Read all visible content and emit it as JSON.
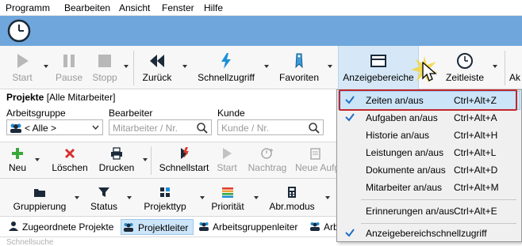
{
  "menubar": {
    "items": [
      "Programm",
      "Bearbeiten",
      "Ansicht",
      "Fenster",
      "Hilfe"
    ]
  },
  "ribbon1": {
    "start": "Start",
    "pause": "Pause",
    "stopp": "Stopp",
    "zurueck": "Zurück",
    "schnellzugriff": "Schnellzugriff",
    "favoriten": "Favoriten",
    "anzeigebereiche": "Anzeigebereiche",
    "zeitleiste": "Zeitleiste",
    "cut_off": "Ak"
  },
  "filter": {
    "title": "Projekte",
    "title_suffix": "[Alle Mitarbeiter]",
    "arbeitsgruppe_label": "Arbeitsgruppe",
    "arbeitsgruppe_value": "< Alle >",
    "bearbeiter_label": "Bearbeiter",
    "bearbeiter_placeholder": "Mitarbeiter / Nr.",
    "kunde_label": "Kunde",
    "kunde_placeholder": "Kunde / Nr."
  },
  "ribbon2": {
    "neu": "Neu",
    "loeschen": "Löschen",
    "drucken": "Drucken",
    "schnellstart": "Schnellstart",
    "start": "Start",
    "nachtrag": "Nachtrag",
    "neu_aufgabe": "Neue Aufg"
  },
  "ribbon3": {
    "gruppierung": "Gruppierung",
    "status": "Status",
    "projekttyp": "Projekttyp",
    "prioritaet": "Priorität",
    "abr_modus": "Abr.modus"
  },
  "tabs": [
    "Zugeordnete Projekte",
    "Projektleiter",
    "Arbeitsgruppenleiter",
    "Arb"
  ],
  "bottom_placeholder": "Schnellsuche",
  "dropdown": {
    "items": [
      {
        "label": "Zeiten an/aus",
        "shortcut": "Ctrl+Alt+Z",
        "checked": true
      },
      {
        "label": "Aufgaben an/aus",
        "shortcut": "Ctrl+Alt+A",
        "checked": true
      },
      {
        "label": "Historie an/aus",
        "shortcut": "Ctrl+Alt+H",
        "checked": false
      },
      {
        "label": "Leistungen an/aus",
        "shortcut": "Ctrl+Alt+L",
        "checked": false
      },
      {
        "label": "Dokumente an/aus",
        "shortcut": "Ctrl+Alt+D",
        "checked": false
      },
      {
        "label": "Mitarbeiter an/aus",
        "shortcut": "Ctrl+Alt+M",
        "checked": false
      },
      {
        "label": "Erinnerungen an/aus",
        "shortcut": "Ctrl+Alt+E",
        "checked": false
      },
      {
        "label": "Anzeigebereichschnellzugriff",
        "shortcut": "",
        "checked": true
      }
    ]
  },
  "colors": {
    "blue_bar": "#6fa7dd",
    "highlight": "#cce4f7",
    "red_outline": "#c3252b",
    "check_blue": "#1f6fc5"
  }
}
